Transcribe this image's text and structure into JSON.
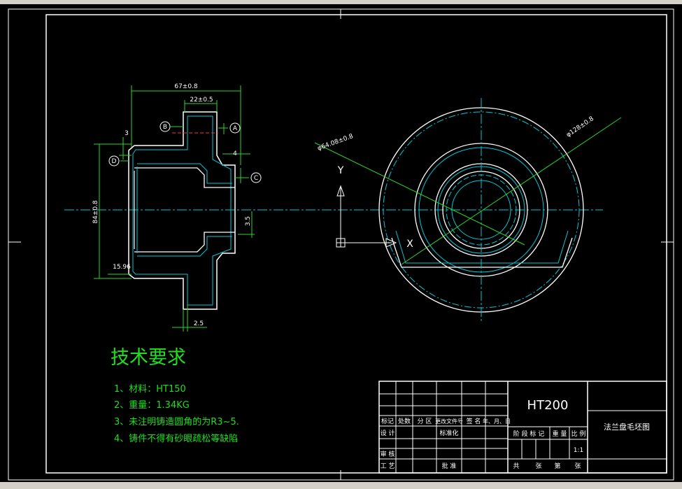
{
  "drawing": {
    "dimensions": {
      "d67": "67±0.8",
      "d22": "22±0.5",
      "d3": "3",
      "d4": "4",
      "d84": "84±0.8",
      "d15": "15.96",
      "d35": "3.5",
      "d25": "2.5",
      "d64": "φ64.08±0.8",
      "d128": "φ128±0.8"
    },
    "datums": {
      "A": "A",
      "B": "B",
      "C": "C",
      "D": "D"
    },
    "ucs": {
      "y": "Y",
      "x": "X"
    }
  },
  "requirements": {
    "title": "技术要求",
    "items": [
      "1、材料：HT150",
      "2、重量：1.34KG",
      "3、未注明铸造圆角的为R3~5.",
      "4、铸件不得有砂眼疏松等缺陷"
    ]
  },
  "title_block": {
    "material": "HT200",
    "drawing_name": "法兰盘毛坯图",
    "scale": "1:1",
    "row_labels": [
      "标记",
      "处数",
      "分 区",
      "更改文件号",
      "签 名",
      "年、月、日"
    ],
    "design": "设 计",
    "standardize": "标准化",
    "review": "审 核",
    "process": "工 艺",
    "approve": "批 准",
    "stage_marks": "阶 段 标 记",
    "weight": "重 量",
    "ratio": "比 例",
    "total_sheets": "共",
    "sheet": "张",
    "sheet_no": "第",
    "sheet2": "张"
  },
  "colors": {
    "background": "#000000",
    "outline": "#ffffff",
    "centerline": "#00c8d8",
    "dimension": "#2bd62b",
    "text_green": "#1de01d"
  }
}
